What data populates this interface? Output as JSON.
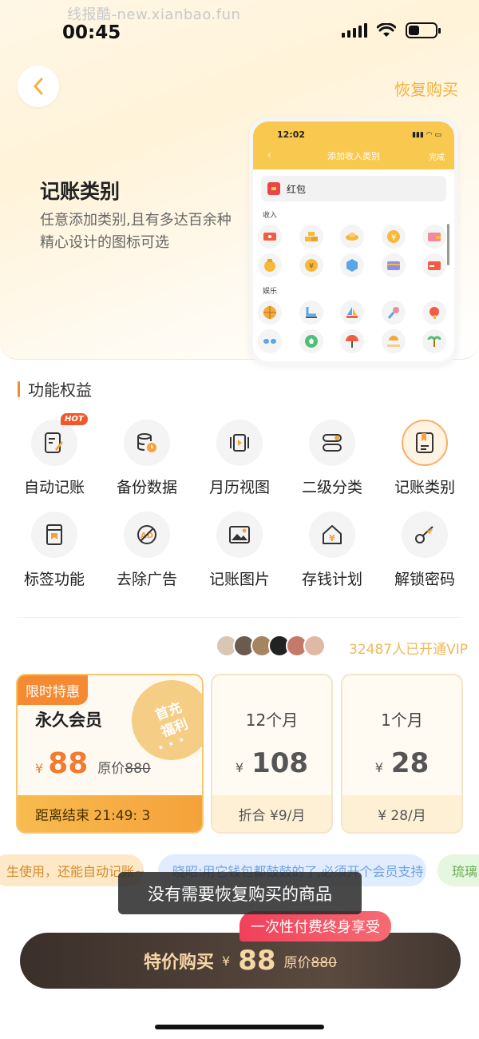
{
  "watermark": "线报酷-new.xianbao.fun",
  "status": {
    "time": "00:45"
  },
  "header": {
    "back_icon": "chevron-left-icon",
    "restore_label": "恢复购买"
  },
  "hero": {
    "title": "记账类别",
    "description": "任意添加类别,且有多达百余种精心设计的图标可选"
  },
  "phone_preview": {
    "time": "12:02",
    "title": "添加收入类别",
    "done": "完成",
    "input_value": "红包",
    "section_income": "收入",
    "section_entertainment": "娱乐"
  },
  "features": {
    "title": "功能权益",
    "hot_badge": "HOT",
    "items": [
      {
        "label": "自动记账",
        "icon": "auto-record-icon"
      },
      {
        "label": "备份数据",
        "icon": "backup-database-icon"
      },
      {
        "label": "月历视图",
        "icon": "calendar-view-icon"
      },
      {
        "label": "二级分类",
        "icon": "subcategory-icon"
      },
      {
        "label": "记账类别",
        "icon": "category-book-icon"
      },
      {
        "label": "标签功能",
        "icon": "bookmark-tag-icon"
      },
      {
        "label": "去除广告",
        "icon": "ad-remove-icon"
      },
      {
        "label": "记账图片",
        "icon": "image-icon"
      },
      {
        "label": "存钱计划",
        "icon": "savings-house-icon"
      },
      {
        "label": "解锁密码",
        "icon": "key-icon"
      }
    ]
  },
  "vip": {
    "count_text": "32487人已开通VIP"
  },
  "plans": {
    "main": {
      "flag": "限时特惠",
      "badge": "首充福利",
      "name": "永久会员",
      "currency": "¥",
      "price": "88",
      "orig_prefix": "原价",
      "orig_price": "880",
      "countdown": "距离结束 21:49: 3"
    },
    "twelve": {
      "name": "12个月",
      "currency": "¥",
      "price": "108",
      "foot": "折合 ¥9/月"
    },
    "one": {
      "name": "1个月",
      "currency": "¥",
      "price": "28",
      "foot": "¥ 28/月"
    }
  },
  "reviews": [
    "生使用，还能自动记账~",
    "晓昭:用它钱包都鼓鼓的了,必须开个会员支持",
    "琉璃:"
  ],
  "toast": "没有需要恢复购买的商品",
  "purchase": {
    "tag": "一次性付费终身享受",
    "label": "特价购买",
    "currency": "¥",
    "price": "88",
    "orig_prefix": "原价",
    "orig_price": "880"
  },
  "colors": {
    "accent": "#f5a23b",
    "gold_text": "#f4b23a",
    "buy_button": "#3a2f2a",
    "tag_red": "#f2405a"
  }
}
